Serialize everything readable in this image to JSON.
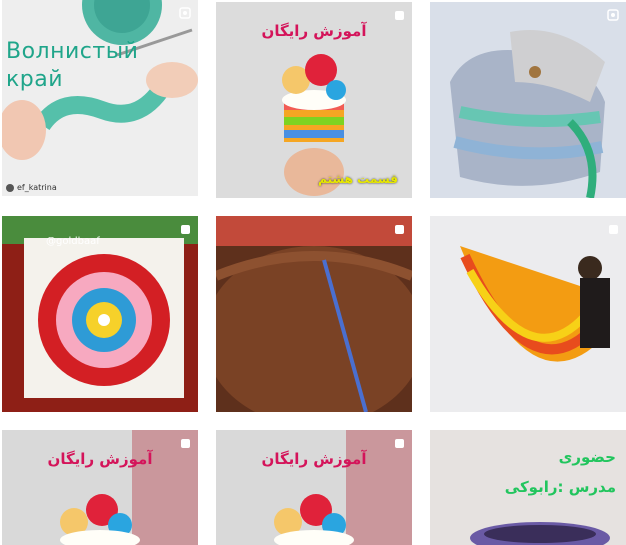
{
  "posts": [
    {
      "caption": "Волнистый\nкрай",
      "username": "ef_katrina",
      "media_icon": "video-icon"
    },
    {
      "caption_title": "آموزش رایگان",
      "caption_sub": "قسمت هشتم",
      "media_icon": "carousel-icon"
    },
    {
      "media_icon": "video-icon"
    },
    {
      "watermark": "@goldbaaf",
      "media_icon": "carousel-icon"
    },
    {
      "media_icon": "carousel-icon"
    },
    {
      "media_icon": "carousel-icon"
    },
    {
      "caption_title": "آموزش رایگان",
      "media_icon": "carousel-icon"
    },
    {
      "caption_title": "آموزش رایگان",
      "media_icon": "carousel-icon"
    },
    {
      "caption_line1": "حضوری",
      "caption_line2": "مدرس :رابوکی"
    }
  ],
  "colors": {
    "accent_pink": "#d4145a",
    "caption_green": "#22c55e",
    "caption_teal": "#1fa58a"
  }
}
